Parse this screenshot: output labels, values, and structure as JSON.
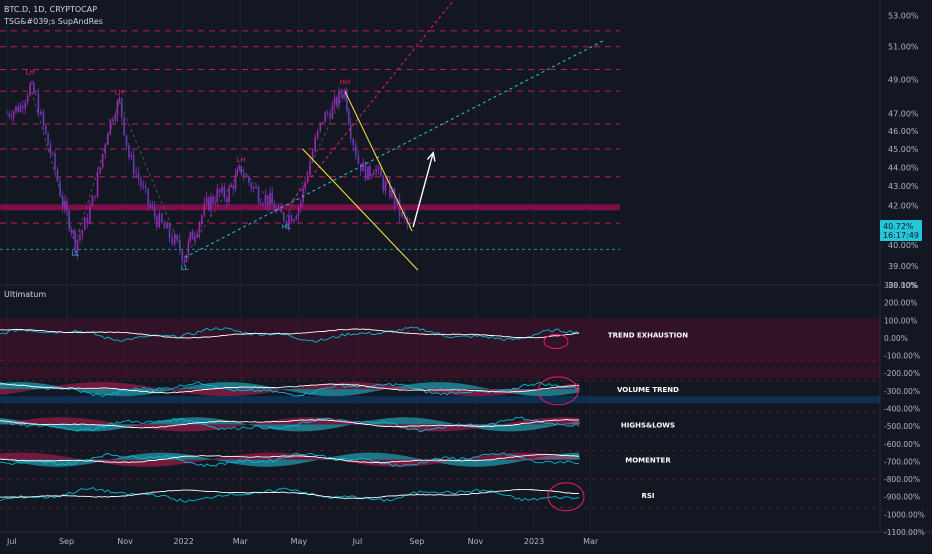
{
  "header": {
    "symbol": "BTC.D, 1D, CRYPTOCAP",
    "indicator": "TSG&#039;s SupAndRes"
  },
  "price_badge": {
    "value": "40.72%",
    "countdown": "16:17:49"
  },
  "subpanel": {
    "title": "Ultimatum"
  },
  "colors": {
    "background": "#131722",
    "up_candle": "#9c27b0",
    "down_candle": "#673ab7",
    "resistance": "#e91e63",
    "support_zone": "#880e4f",
    "channel_top": "#e91e63",
    "channel_bottom": "#26c6da",
    "wedge": "#ffeb3b",
    "arrow": "#ffffff",
    "badge": "#26c6da",
    "osc_cyan": "#00bcd4",
    "osc_white": "#ffffff",
    "osc_pink": "#e91e63"
  },
  "chart_data": [
    {
      "type": "line",
      "subtype": "candlestick",
      "xlabels": [
        "Jul",
        "Sep",
        "Nov",
        "2022",
        "Mar",
        "May",
        "Jul",
        "Sep",
        "Nov",
        "2023",
        "Mar"
      ],
      "ylabels": [
        "53.00%",
        "51.00%",
        "49.00%",
        "47.00%",
        "46.00%",
        "45.00%",
        "44.00%",
        "43.00%",
        "42.00%",
        "41.00%",
        "40.00%",
        "39.00%",
        "38.10%"
      ],
      "ylim": [
        38.1,
        54.0
      ],
      "y_scale": "log",
      "close_series": [
        [
          "2021-07-01",
          47.0
        ],
        [
          "2021-07-15",
          47.4
        ],
        [
          "2021-07-25",
          48.6
        ],
        [
          "2021-07-31",
          47.9
        ],
        [
          "2021-08-08",
          46.2
        ],
        [
          "2021-08-20",
          43.9
        ],
        [
          "2021-08-28",
          42.1
        ],
        [
          "2021-09-06",
          40.9
        ],
        [
          "2021-09-10",
          40.1
        ],
        [
          "2021-09-20",
          41.0
        ],
        [
          "2021-09-28",
          42.2
        ],
        [
          "2021-10-06",
          44.0
        ],
        [
          "2021-10-14",
          46.2
        ],
        [
          "2021-10-22",
          47.3
        ],
        [
          "2021-10-26",
          47.7
        ],
        [
          "2021-11-05",
          44.6
        ],
        [
          "2021-11-15",
          43.4
        ],
        [
          "2021-11-25",
          42.1
        ],
        [
          "2021-12-04",
          41.3
        ],
        [
          "2021-12-12",
          40.8
        ],
        [
          "2021-12-20",
          40.3
        ],
        [
          "2021-12-28",
          39.8
        ],
        [
          "2022-01-02",
          39.4
        ],
        [
          "2022-01-08",
          40.3
        ],
        [
          "2022-01-15",
          41.0
        ],
        [
          "2022-01-25",
          42.0
        ],
        [
          "2022-02-05",
          42.6
        ],
        [
          "2022-02-15",
          42.5
        ],
        [
          "2022-02-24",
          43.4
        ],
        [
          "2022-03-02",
          43.9
        ],
        [
          "2022-03-10",
          43.2
        ],
        [
          "2022-03-20",
          42.6
        ],
        [
          "2022-04-01",
          42.2
        ],
        [
          "2022-04-10",
          41.5
        ],
        [
          "2022-04-18",
          41.4
        ],
        [
          "2022-04-26",
          41.6
        ],
        [
          "2022-05-03",
          42.2
        ],
        [
          "2022-05-10",
          43.8
        ],
        [
          "2022-05-18",
          45.4
        ],
        [
          "2022-05-26",
          46.7
        ],
        [
          "2022-06-05",
          47.3
        ],
        [
          "2022-06-14",
          48.2
        ],
        [
          "2022-06-18",
          48.3
        ],
        [
          "2022-06-24",
          46.0
        ],
        [
          "2022-07-02",
          44.3
        ],
        [
          "2022-07-12",
          43.6
        ],
        [
          "2022-07-18",
          44.1
        ],
        [
          "2022-07-28",
          43.1
        ],
        [
          "2022-08-06",
          42.6
        ],
        [
          "2022-08-14",
          41.6
        ],
        [
          "2022-08-22",
          41.0
        ],
        [
          "2022-08-27",
          40.7
        ]
      ],
      "annotations": [
        {
          "text": "LH",
          "x": "2021-07-25",
          "y": 49.3
        },
        {
          "text": "LH",
          "x": "2021-10-26",
          "y": 48.1
        },
        {
          "text": "LL",
          "x": "2021-09-10",
          "y": 39.8
        },
        {
          "text": "LL",
          "x": "2022-01-02",
          "y": 39.1
        },
        {
          "text": "LH",
          "x": "2022-03-02",
          "y": 44.3
        },
        {
          "text": "HL",
          "x": "2022-04-18",
          "y": 41.1
        },
        {
          "text": "HH",
          "x": "2022-06-18",
          "y": 48.7
        }
      ],
      "horizontal_levels": [
        52.0,
        51.0,
        49.6,
        48.3,
        46.4,
        45.0,
        43.5,
        41.1
      ],
      "support_zone": [
        41.75,
        42.05
      ],
      "dotted_support": 39.8,
      "ascending_channel_top": [
        [
          "2022-04-20",
          42.0
        ],
        [
          "2023-01-12",
          62.0
        ]
      ],
      "ascending_channel_bottom": [
        [
          "2022-01-02",
          39.4
        ],
        [
          "2023-03-15",
          51.4
        ]
      ],
      "falling_wedge_upper": [
        [
          "2022-06-18",
          48.3
        ],
        [
          "2022-08-27",
          40.7
        ]
      ],
      "falling_wedge_lower": [
        [
          "2022-05-05",
          45.0
        ],
        [
          "2022-09-02",
          38.8
        ]
      ],
      "projection_arrow": [
        [
          "2022-08-28",
          40.9
        ],
        [
          "2022-09-18",
          44.8
        ]
      ]
    },
    {
      "type": "line",
      "title": "Ultimatum",
      "ylabels": [
        "300.00%",
        "200.00%",
        "100.00%",
        "0.00%",
        "-100.00%",
        "-200.00%",
        "-300.00%",
        "-400.00%",
        "-500.00%",
        "-600.00%",
        "-700.00%",
        "-800.00%",
        "-900.00%",
        "-1000.00%",
        "-1100.00%"
      ],
      "ylim": [
        -1100,
        300
      ],
      "panels": [
        {
          "label": "TREND EXHAUSTION",
          "center": 20
        },
        {
          "label": "VOLUME TREND",
          "center": -290
        },
        {
          "label": "HIGHS&LOWS",
          "center": -490
        },
        {
          "label": "MOMENTER",
          "center": -690
        },
        {
          "label": "RSI",
          "center": -890
        }
      ]
    }
  ]
}
